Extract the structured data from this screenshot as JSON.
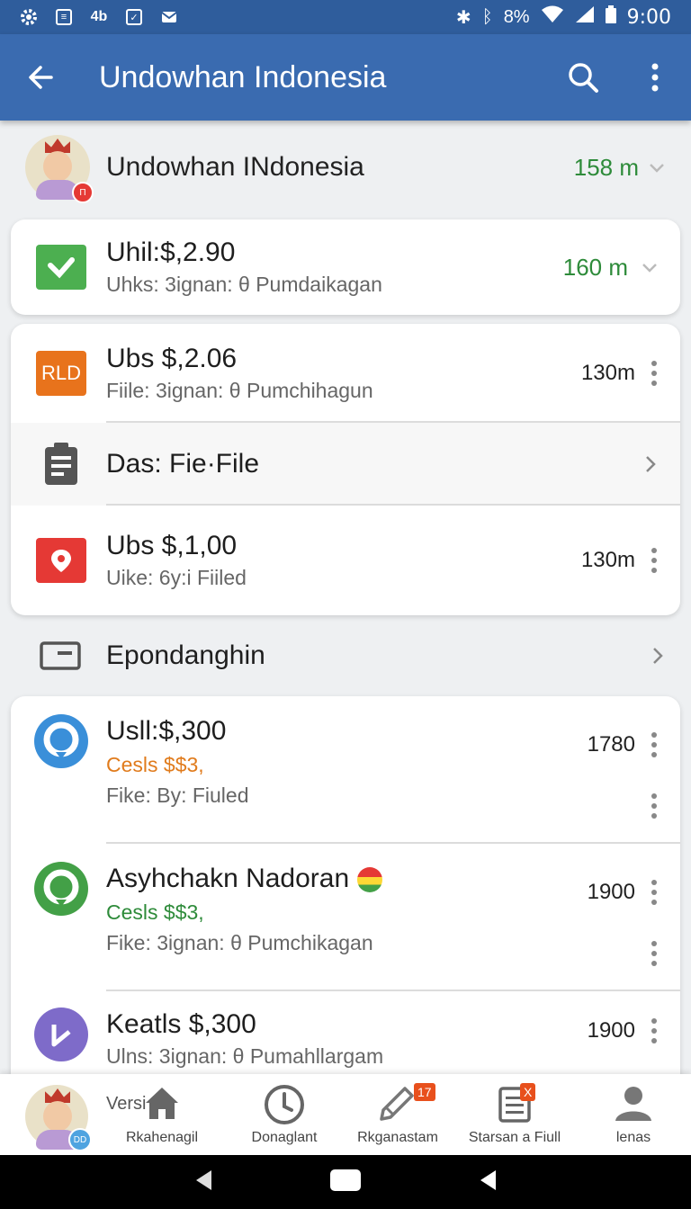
{
  "status_bar": {
    "battery": "8%",
    "time": "9:00",
    "left_icon_label": "4b"
  },
  "app_bar": {
    "title": "Undowhan Indonesia"
  },
  "header": {
    "name": "Undowhan INdonesia",
    "meta": "158 m",
    "avatar_badge": "Π"
  },
  "card1": {
    "title": "Uhil:$,2.90",
    "subtitle": "Uhks: 3ignan: θ Pumdaikagan",
    "meta": "160 m",
    "icon_color": "#4caf50"
  },
  "card2": {
    "rows": [
      {
        "icon_text": "RLD",
        "title": "Ubs $,2.06",
        "subtitle": "Fiile: 3ignan: θ Pumchihagun",
        "meta": "130m"
      },
      {
        "title": "Das: Fie·File"
      },
      {
        "title": "Ubs $,1,00",
        "subtitle": "Uike: 6y:i Fiiled",
        "meta": "130m"
      }
    ]
  },
  "section": {
    "title": "Epondanghin"
  },
  "card3": {
    "rows": [
      {
        "title": "Usll:$,300",
        "accent": "Cesls $$3,",
        "subtitle": "Fike: By: Fiuled",
        "meta": "1780"
      },
      {
        "title": "Asyhchakn Nadoran",
        "accent": "Cesls $$3,",
        "subtitle": "Fike: 3ignan: θ Pumchikagan",
        "meta": "1900"
      },
      {
        "title": "Keatls $,300",
        "subtitle": "Ulns: 3ignan: θ Pumahllargam",
        "meta": "1900"
      }
    ]
  },
  "bottom_nav": {
    "versi": "Versi",
    "items": [
      {
        "label": "Rkahenagil",
        "icon": "home-icon"
      },
      {
        "label": "Donaglant",
        "icon": "clock-icon"
      },
      {
        "label": "Rkganastam",
        "icon": "pen-icon",
        "badge": "17"
      },
      {
        "label": "Starsan a Fiull",
        "icon": "clipboard-icon",
        "badge": "X"
      },
      {
        "label": "lenas",
        "icon": "person-icon"
      }
    ],
    "avatar_badge": "DD"
  },
  "colors": {
    "appbar": "#3a6bb0",
    "green": "#2e8b3a",
    "orange": "#e07b1c"
  }
}
